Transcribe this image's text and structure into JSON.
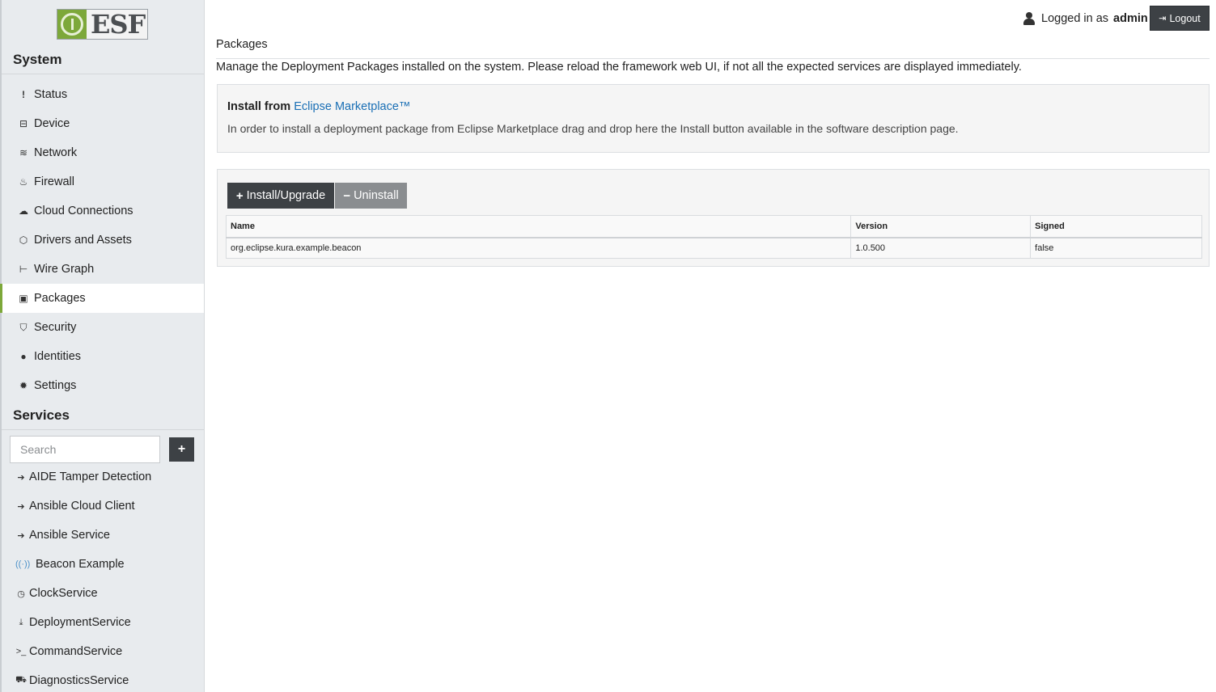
{
  "app": {
    "logo_text": "ESF"
  },
  "sidebar": {
    "system_title": "System",
    "items": [
      {
        "label": "Status",
        "icon": "exclamation-icon"
      },
      {
        "label": "Device",
        "icon": "hdd-icon"
      },
      {
        "label": "Network",
        "icon": "wifi-icon"
      },
      {
        "label": "Firewall",
        "icon": "fire-icon"
      },
      {
        "label": "Cloud Connections",
        "icon": "cloud-icon"
      },
      {
        "label": "Drivers and Assets",
        "icon": "cube-icon"
      },
      {
        "label": "Wire Graph",
        "icon": "sitemap-icon"
      },
      {
        "label": "Packages",
        "icon": "briefcase-icon",
        "active": true
      },
      {
        "label": "Security",
        "icon": "shield-icon"
      },
      {
        "label": "Identities",
        "icon": "user-icon"
      },
      {
        "label": "Settings",
        "icon": "gear-icon"
      }
    ],
    "services_title": "Services",
    "search_placeholder": "Search",
    "add_label": "+",
    "services": [
      {
        "label": "AIDE Tamper Detection",
        "icon": "chevron-circle-right-icon"
      },
      {
        "label": "Ansible Cloud Client",
        "icon": "chevron-circle-right-icon"
      },
      {
        "label": "Ansible Service",
        "icon": "chevron-circle-right-icon"
      },
      {
        "label": "Beacon Example",
        "icon": "beacon-icon"
      },
      {
        "label": "ClockService",
        "icon": "clock-icon"
      },
      {
        "label": "DeploymentService",
        "icon": "download-icon"
      },
      {
        "label": "CommandService",
        "icon": "terminal-icon"
      },
      {
        "label": "DiagnosticsService",
        "icon": "ambulance-icon"
      }
    ]
  },
  "header": {
    "logged_in_text": "Logged in as",
    "username": "admin",
    "logout_label": "Logout"
  },
  "main": {
    "title": "Packages",
    "description": "Manage the Deployment Packages installed on the system. Please reload the framework web UI, if not all the expected services are displayed immediately.",
    "install_from": "Install from",
    "marketplace_link": "Eclipse Marketplace™",
    "marketplace_desc": "In order to install a deployment package from Eclipse Marketplace drag and drop here the Install button available in the software description page.",
    "install_button": "Install/Upgrade",
    "uninstall_button": "Uninstall",
    "table": {
      "columns": [
        "Name",
        "Version",
        "Signed"
      ],
      "rows": [
        [
          "org.eclipse.kura.example.beacon",
          "1.0.500",
          "false"
        ]
      ]
    }
  },
  "colors": {
    "accent": "#7da83a",
    "link": "#1a6fb5",
    "dark_button": "#3d4145"
  }
}
